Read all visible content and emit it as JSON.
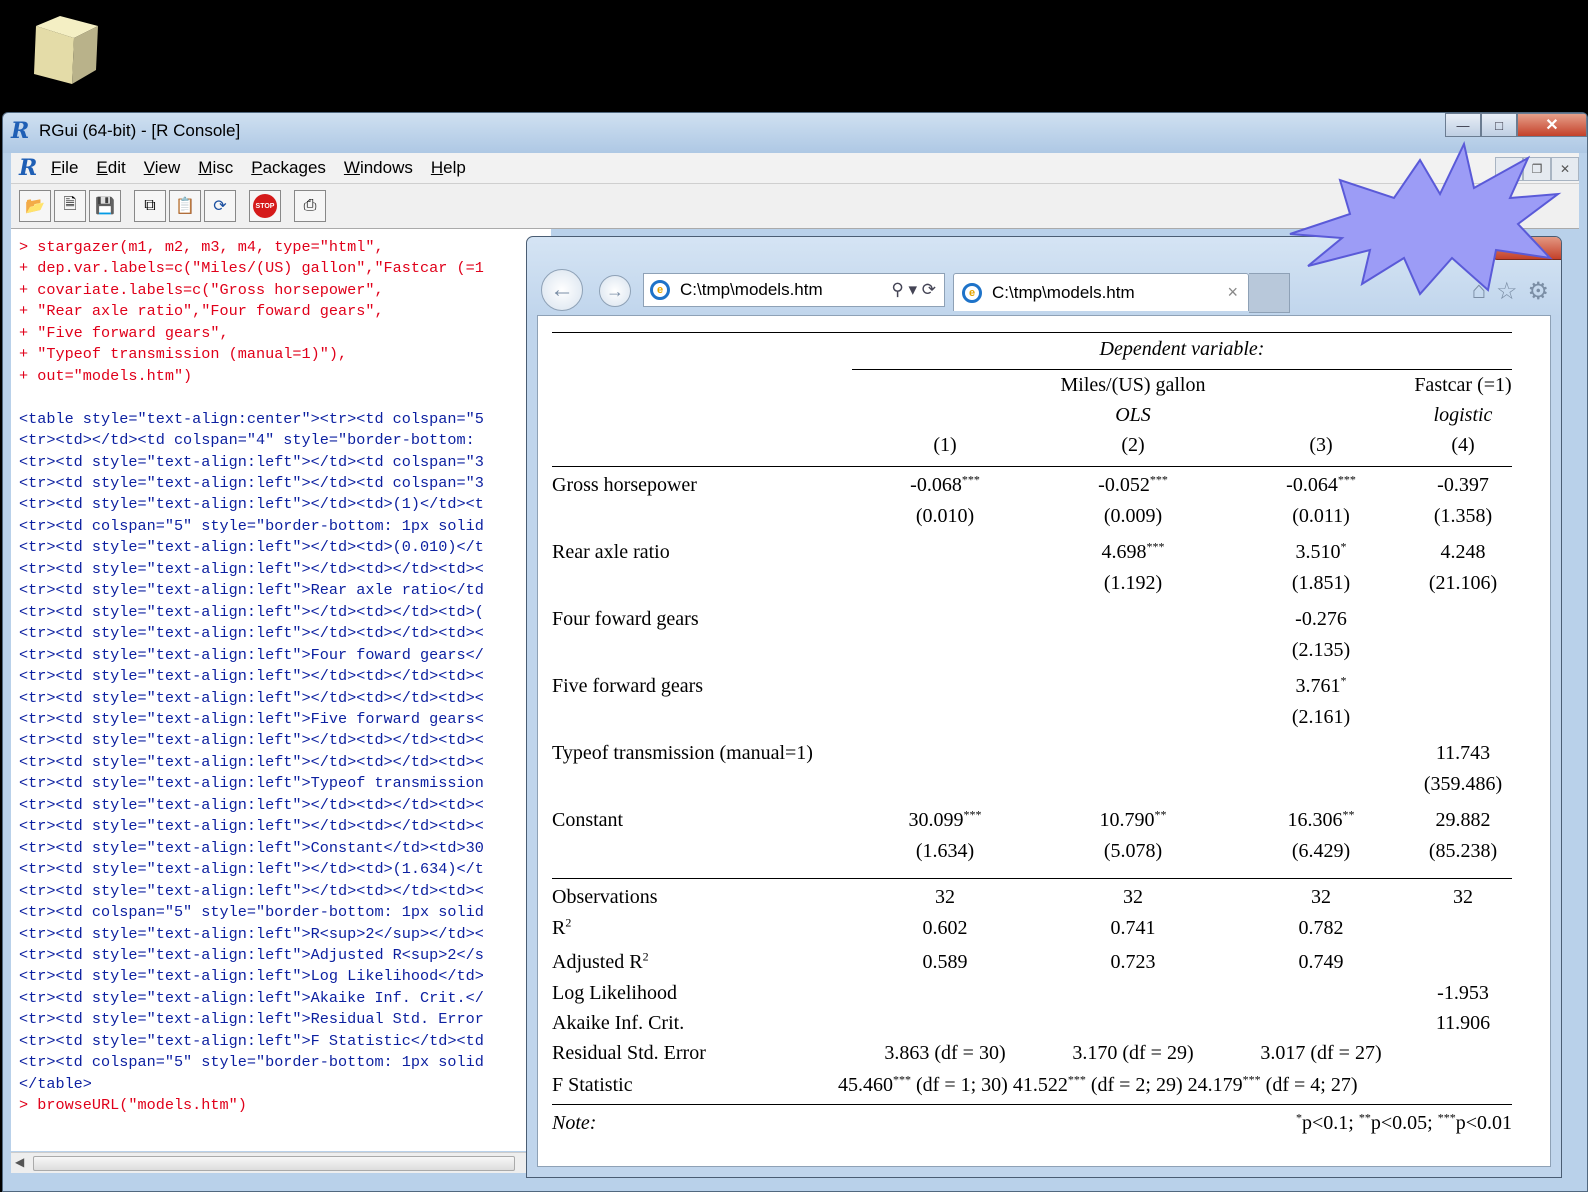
{
  "rgui": {
    "title": "RGui (64-bit) - [R Console]",
    "logo": "R",
    "menu": [
      "File",
      "Edit",
      "View",
      "Misc",
      "Packages",
      "Windows",
      "Help"
    ],
    "toolbar_icons": [
      "open-script-icon",
      "load-workspace-icon",
      "save-icon",
      "copy-icon",
      "paste-icon",
      "refresh-icon",
      "stop-icon",
      "print-icon"
    ],
    "stop_label": "STOP"
  },
  "console": {
    "command_lines": [
      "> stargazer(m1, m2, m3, m4, type=\"html\",",
      "+ dep.var.labels=c(\"Miles/(US) gallon\",\"Fastcar (=1",
      "+ covariate.labels=c(\"Gross horsepower\",",
      "+ \"Rear axle ratio\",\"Four foward gears\",",
      "+ \"Five forward gears\",",
      "+ \"Typeof transmission (manual=1)\"),",
      "+ out=\"models.htm\")"
    ],
    "output_lines": [
      "<table style=\"text-align:center\"><tr><td colspan=\"5",
      "<tr><td></td><td colspan=\"4\" style=\"border-bottom: ",
      "<tr><td style=\"text-align:left\"></td><td colspan=\"3",
      "<tr><td style=\"text-align:left\"></td><td colspan=\"3",
      "<tr><td style=\"text-align:left\"></td><td>(1)</td><t",
      "<tr><td colspan=\"5\" style=\"border-bottom: 1px solid",
      "<tr><td style=\"text-align:left\"></td><td>(0.010)</t",
      "<tr><td style=\"text-align:left\"></td><td></td><td><",
      "<tr><td style=\"text-align:left\">Rear axle ratio</td",
      "<tr><td style=\"text-align:left\"></td><td></td><td>(",
      "<tr><td style=\"text-align:left\"></td><td></td><td><",
      "<tr><td style=\"text-align:left\">Four foward gears</",
      "<tr><td style=\"text-align:left\"></td><td></td><td><",
      "<tr><td style=\"text-align:left\"></td><td></td><td><",
      "<tr><td style=\"text-align:left\">Five forward gears<",
      "<tr><td style=\"text-align:left\"></td><td></td><td><",
      "<tr><td style=\"text-align:left\"></td><td></td><td><",
      "<tr><td style=\"text-align:left\">Typeof transmission",
      "<tr><td style=\"text-align:left\"></td><td></td><td><",
      "<tr><td style=\"text-align:left\"></td><td></td><td><",
      "<tr><td style=\"text-align:left\">Constant</td><td>30",
      "<tr><td style=\"text-align:left\"></td><td>(1.634)</t",
      "<tr><td style=\"text-align:left\"></td><td></td><td><",
      "<tr><td colspan=\"5\" style=\"border-bottom: 1px solid",
      "<tr><td style=\"text-align:left\">R<sup>2</sup></td><",
      "<tr><td style=\"text-align:left\">Adjusted R<sup>2</s",
      "<tr><td style=\"text-align:left\">Log Likelihood</td>",
      "<tr><td style=\"text-align:left\">Akaike Inf. Crit.</",
      "<tr><td style=\"text-align:left\">Residual Std. Error",
      "<tr><td style=\"text-align:left\">F Statistic</td><td",
      "<tr><td colspan=\"5\" style=\"border-bottom: 1px solid",
      "</table>"
    ],
    "final_command": "> browseURL(\"models.htm\")"
  },
  "browser": {
    "address": "C:\\tmp\\models.htm",
    "tab_title": "C:\\tmp\\models.htm",
    "tab_close": "×"
  },
  "regression_table": {
    "dependent_variable": "Dependent variable:",
    "dep_labels": [
      "Miles/(US) gallon",
      "Fastcar (=1)"
    ],
    "model_types": [
      "OLS",
      "logistic"
    ],
    "model_numbers": [
      "(1)",
      "(2)",
      "(3)",
      "(4)"
    ],
    "covariates": [
      {
        "label": "Gross horsepower",
        "coef": [
          "-0.068",
          "-0.052",
          "-0.064",
          "-0.397"
        ],
        "stars": [
          "***",
          "***",
          "***",
          ""
        ],
        "se": [
          "(0.010)",
          "(0.009)",
          "(0.011)",
          "(1.358)"
        ]
      },
      {
        "label": "Rear axle ratio",
        "coef": [
          "",
          "4.698",
          "3.510",
          "4.248"
        ],
        "stars": [
          "",
          "***",
          "*",
          ""
        ],
        "se": [
          "",
          "(1.192)",
          "(1.851)",
          "(21.106)"
        ]
      },
      {
        "label": "Four foward gears",
        "coef": [
          "",
          "",
          "-0.276",
          ""
        ],
        "stars": [
          "",
          "",
          "",
          ""
        ],
        "se": [
          "",
          "",
          "(2.135)",
          ""
        ]
      },
      {
        "label": "Five forward gears",
        "coef": [
          "",
          "",
          "3.761",
          ""
        ],
        "stars": [
          "",
          "",
          "*",
          ""
        ],
        "se": [
          "",
          "",
          "(2.161)",
          ""
        ]
      },
      {
        "label": "Typeof transmission (manual=1)",
        "coef": [
          "",
          "",
          "",
          "11.743"
        ],
        "stars": [
          "",
          "",
          "",
          ""
        ],
        "se": [
          "",
          "",
          "",
          "(359.486)"
        ]
      },
      {
        "label": "Constant",
        "coef": [
          "30.099",
          "10.790",
          "16.306",
          "29.882"
        ],
        "stars": [
          "***",
          "**",
          "**",
          ""
        ],
        "se": [
          "(1.634)",
          "(5.078)",
          "(6.429)",
          "(85.238)"
        ]
      }
    ],
    "stats": {
      "observations": {
        "label": "Observations",
        "values": [
          "32",
          "32",
          "32",
          "32"
        ]
      },
      "r2": {
        "label": "R",
        "sup": "2",
        "values": [
          "0.602",
          "0.741",
          "0.782",
          ""
        ]
      },
      "adj_r2": {
        "label": "Adjusted R",
        "sup": "2",
        "values": [
          "0.589",
          "0.723",
          "0.749",
          ""
        ]
      },
      "log_likelihood": {
        "label": "Log Likelihood",
        "values": [
          "",
          "",
          "",
          "-1.953"
        ]
      },
      "aic": {
        "label": "Akaike Inf. Crit.",
        "values": [
          "",
          "",
          "",
          "11.906"
        ]
      },
      "resid_se": {
        "label": "Residual Std. Error",
        "values": [
          "3.863 (df = 30)",
          "3.170 (df = 29)",
          "3.017 (df = 27)",
          ""
        ]
      },
      "f_stat": {
        "label": "F Statistic",
        "parts": [
          {
            "value": "45.460",
            "stars": "***",
            "df": " (df = 1; 30)"
          },
          {
            "value": " 41.522",
            "stars": "***",
            "df": " (df = 2; 29)"
          },
          {
            "value": " 24.179",
            "stars": "***",
            "df": " (df = 4; 27)"
          }
        ]
      }
    },
    "note_label": "Note:",
    "note": [
      {
        "stars": "*",
        "text": "p<0.1; "
      },
      {
        "stars": "**",
        "text": "p<0.05; "
      },
      {
        "stars": "***",
        "text": "p<0.01"
      }
    ]
  },
  "colors": {
    "burst": "#9c9cf6",
    "command": "#e0001a",
    "output": "#0b1fa0"
  }
}
